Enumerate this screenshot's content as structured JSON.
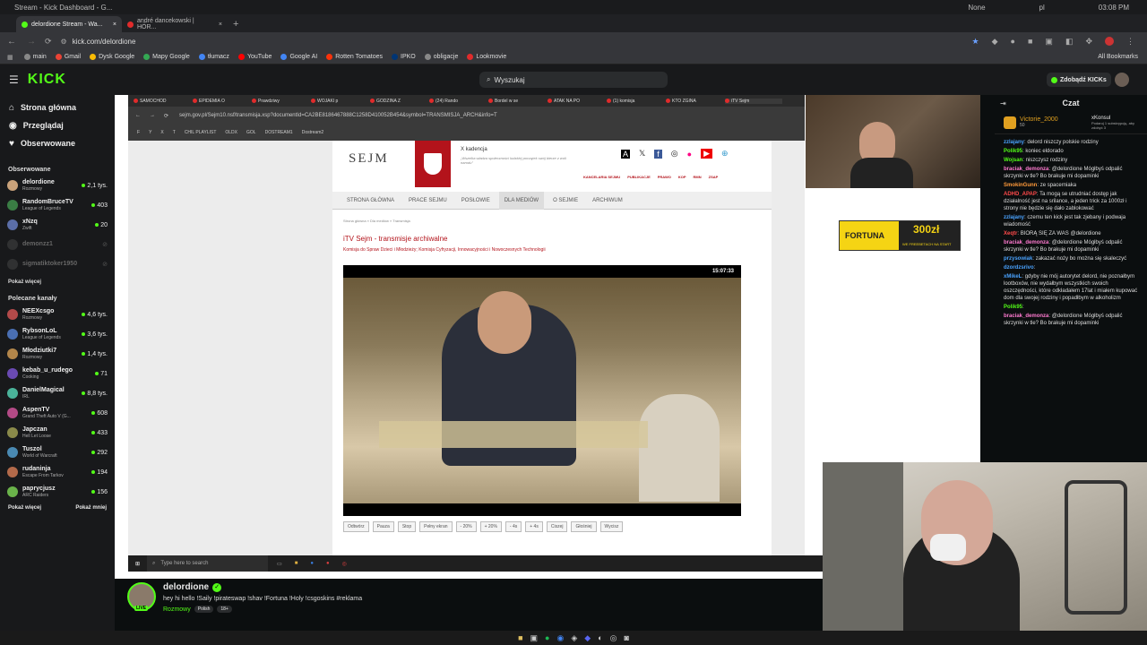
{
  "os": {
    "tab_text": "Stream - Kick Dashboard - G...",
    "user1": "None",
    "user2": "pl",
    "time": "03:08 PM"
  },
  "tabs": [
    {
      "label": "delordione Stream - Wa...",
      "color": "#53fc18"
    },
    {
      "label": "andré dancekowski | HÖR...",
      "color": "#e02b2b"
    }
  ],
  "address": {
    "url": "kick.com/delordione"
  },
  "bookmarks": [
    {
      "label": "main",
      "color": "#888"
    },
    {
      "label": "Gmail",
      "color": "#ea4335"
    },
    {
      "label": "Dysk Google",
      "color": "#fbbc04"
    },
    {
      "label": "Mapy Google",
      "color": "#34a853"
    },
    {
      "label": "tłumacz",
      "color": "#4285f4"
    },
    {
      "label": "YouTube",
      "color": "#ff0000"
    },
    {
      "label": "Google AI",
      "color": "#4285f4"
    },
    {
      "label": "Rotten Tomatoes",
      "color": "#fa320a"
    },
    {
      "label": "IPKO",
      "color": "#003574"
    },
    {
      "label": "obligacje",
      "color": "#888"
    },
    {
      "label": "Lookmovie",
      "color": "#e02b2b"
    }
  ],
  "all_bookmarks": "All Bookmarks",
  "kick": {
    "search_placeholder": "Wyszukaj",
    "get_kicks": "Zdobądź KICKs",
    "nav": [
      {
        "label": "Strona główna",
        "icon": "home-icon"
      },
      {
        "label": "Przeglądaj",
        "icon": "compass-icon"
      },
      {
        "label": "Obserwowane",
        "icon": "heart-icon"
      }
    ],
    "followed_title": "Obserwowane",
    "followed": [
      {
        "name": "delordione",
        "cat": "Rozmowy",
        "viewers": "2,1 tys.",
        "color": "#c9a27a",
        "live": true
      },
      {
        "name": "RandomBruceTV",
        "cat": "League of Legends",
        "viewers": "403",
        "color": "#3a7d44",
        "live": true
      },
      {
        "name": "xNzq",
        "cat": "Zwift",
        "viewers": "20",
        "color": "#5b6ea8",
        "live": true
      },
      {
        "name": "demonzz1",
        "cat": "",
        "viewers": "",
        "color": "#555",
        "live": false
      },
      {
        "name": "sigmatiktoker1950",
        "cat": "",
        "viewers": "",
        "color": "#555",
        "live": false
      }
    ],
    "show_more": "Pokaż więcej",
    "recommended_title": "Polecane kanały",
    "recommended": [
      {
        "name": "NEEXcsgo",
        "cat": "Rozmowy",
        "viewers": "4,6 tys.",
        "color": "#b34a4a"
      },
      {
        "name": "RybsonLoL",
        "cat": "League of Legends",
        "viewers": "3,6 tys.",
        "color": "#4a6fb3"
      },
      {
        "name": "Młodziutki7",
        "cat": "Rozmowy",
        "viewers": "1,4 tys.",
        "color": "#b3864a"
      },
      {
        "name": "kebab_u_rudego",
        "cat": "Cooking",
        "viewers": "71",
        "color": "#6a4ab3"
      },
      {
        "name": "DanielMagical",
        "cat": "IRL",
        "viewers": "8,8 tys.",
        "color": "#4ab39a"
      },
      {
        "name": "AspenTV",
        "cat": "Grand Theft Auto V (G...",
        "viewers": "608",
        "color": "#b34a86"
      },
      {
        "name": "Japczan",
        "cat": "Hell Let Loose",
        "viewers": "433",
        "color": "#8a8a4a"
      },
      {
        "name": "Tuszol",
        "cat": "World of Warcraft",
        "viewers": "292",
        "color": "#4a8ab3"
      },
      {
        "name": "rudaninja",
        "cat": "Escape From Tarkov",
        "viewers": "194",
        "color": "#b36a4a"
      },
      {
        "name": "paprycjusz",
        "cat": "ARC Raiders",
        "viewers": "156",
        "color": "#6ab34a"
      }
    ],
    "show_less": "Pokaż mniej"
  },
  "inner": {
    "tabs": [
      "SAMOCHOD",
      "EPIDEMIA O",
      "Prawdziwy",
      "WOJAKI p",
      "GODZINA Z",
      "(24) Rando",
      "Bordel w se",
      "ATAK NA PO",
      "(1) komisja",
      "KTO ZGINA",
      "iTV Sejm"
    ],
    "url": "sejm.gov.pl/Sejm10.nsf/transmisja.xsp?documentId=CA2BE8186467888C1258D410052B454&symbol=TRANSMISJA_ARCH&info=T",
    "bookmarks": [
      "F",
      "Y",
      "X",
      "T",
      "CHIL PLAYLIST",
      "OLDX",
      "GOL",
      "DOSTREAM1",
      "Dostream2"
    ],
    "sejm_logo": "SEJM",
    "kadencja": "X kadencja",
    "motto": "„Wszelka władza społeczności ludzkiej początek swój bierze z woli narodu”",
    "top_links": [
      "KANCELARIA SEJMU",
      "PUBLIKACJE",
      "PRAWO",
      "KOP",
      "RMN",
      "ZSAP"
    ],
    "menu": [
      "STRONA GŁÓWNA",
      "PRACE SEJMU",
      "POSŁOWIE",
      "DLA MEDIÓW",
      "O SEJMIE",
      "ARCHIWUM"
    ],
    "breadcrumb": "Strona główna  »  Dla mediów  »  Transmisja",
    "heading": "iTV Sejm - transmisje archiwalne",
    "subheading": "Komisja do Spraw Dzieci i Młodzieży; Komisja Cyfryzacji, Innowacyjności i Nowoczesnych Technologii",
    "video_time": "15:07:33",
    "controls": [
      "Odtwórz",
      "Pauza",
      "Stop",
      "Pełny ekran",
      "- 20%",
      "+ 20%",
      "- 4s",
      "+ 4s",
      "Ciszej",
      "Głośniej",
      "Wycisz"
    ],
    "taskbar_search": "Type here to search",
    "ad_brand": "FORTUNA",
    "ad_amount": "300zł",
    "ad_sub": "WE FREEBETACH NA START"
  },
  "chat": {
    "title": "Czat",
    "pinned_user": "Victorie_2000",
    "pinned_count": "50",
    "pinned_gift_user": "xKonsul",
    "pinned_gift_text": "Podaruj 1 subskrypcję, aby zdobyć 3",
    "messages": [
      {
        "user": "zzlajany",
        "color": "#4aa3ff",
        "text": "delord niszczy polskie rodziny"
      },
      {
        "user": "Polik95",
        "color": "#53fc18",
        "text": "koniec eldorado"
      },
      {
        "user": "Wojsan",
        "color": "#53fc18",
        "text": "niszczysz rodziny"
      },
      {
        "user": "braciak_demonza",
        "color": "#ff7ad0",
        "text": "@delordione Mógłbyś odpalić skrzynki w tle? Bo brakuje mi dopaminki"
      },
      {
        "user": "SmokinGunn",
        "color": "#ff9a3a",
        "text": "ze spacerniaka"
      },
      {
        "user": "ADHD_APAP",
        "color": "#ff4a4a",
        "text": "Ta mogą se utrudniać dostęp jak działalność jest na srilance, a jeden trick za 1000zł i strony nie będzie się dało zablokować"
      },
      {
        "user": "zzlajany",
        "color": "#4aa3ff",
        "text": "czemu ten kick jest tak zjebany i podwaja wiadomość"
      },
      {
        "user": "Xeqtr",
        "color": "#ff4a4a",
        "text": "BIORĄ SIĘ ZA WAS @delordione"
      },
      {
        "user": "braciak_demonza",
        "color": "#ff7ad0",
        "text": "@delordione Mógłbyś odpalić skrzynki w tle? Bo brakuje mi dopaminki"
      },
      {
        "user": "przysowiak",
        "color": "#4aa3ff",
        "text": "zakazać noży bo można się skaleczyć"
      },
      {
        "user": "dzordzsrivo",
        "color": "#4aa3ff",
        "text": ""
      },
      {
        "user": "xMikeL",
        "color": "#4aa3ff",
        "text": "gdyby nie mój autorytet delord, nie poznałbym lootboxów, nie wydałbym wszystkich swoich oszczędności, które odkładałem 17lat i miałem kupować dom dla swojej rodziny i popadłbym w alkoholizm"
      },
      {
        "user": "Polik95",
        "color": "#53fc18",
        "text": ""
      },
      {
        "user": "braciak_demonza",
        "color": "#ff7ad0",
        "text": "@delordione Mógłbyś odpalić skrzynki w tle? Bo brakuje mi dopaminki"
      }
    ]
  },
  "streamer": {
    "name": "delordione",
    "title": "hey hi hello  !Saily !pirateswap !shav !Fortuna !Holy !csgoskins  #reklama",
    "category": "Rozmowy",
    "tag1": "Polish",
    "tag2": "18+",
    "live_label": "LIVE"
  }
}
